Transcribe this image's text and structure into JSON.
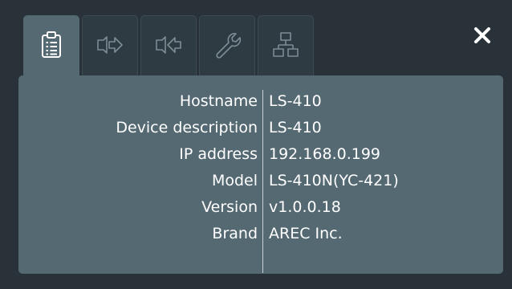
{
  "tabs": [
    {
      "icon": "clipboard-icon",
      "active": true
    },
    {
      "icon": "arrow-right-icon",
      "active": false
    },
    {
      "icon": "arrow-left-icon",
      "active": false
    },
    {
      "icon": "wrench-icon",
      "active": false
    },
    {
      "icon": "network-icon",
      "active": false
    }
  ],
  "close_label": "✕",
  "info": [
    {
      "label": "Hostname",
      "value": "LS-410"
    },
    {
      "label": "Device description",
      "value": "LS-410"
    },
    {
      "label": "IP address",
      "value": "192.168.0.199"
    },
    {
      "label": "Model",
      "value": "LS-410N(YC-421)"
    },
    {
      "label": "Version",
      "value": "v1.0.0.18"
    },
    {
      "label": "Brand",
      "value": "AREC Inc."
    }
  ],
  "colors": {
    "background": "#283238",
    "panel": "#556973",
    "tab_inactive": "#2f3b42",
    "text": "#ffffff",
    "icon_active": "#ffffff",
    "icon_inactive": "#7d8d95"
  }
}
